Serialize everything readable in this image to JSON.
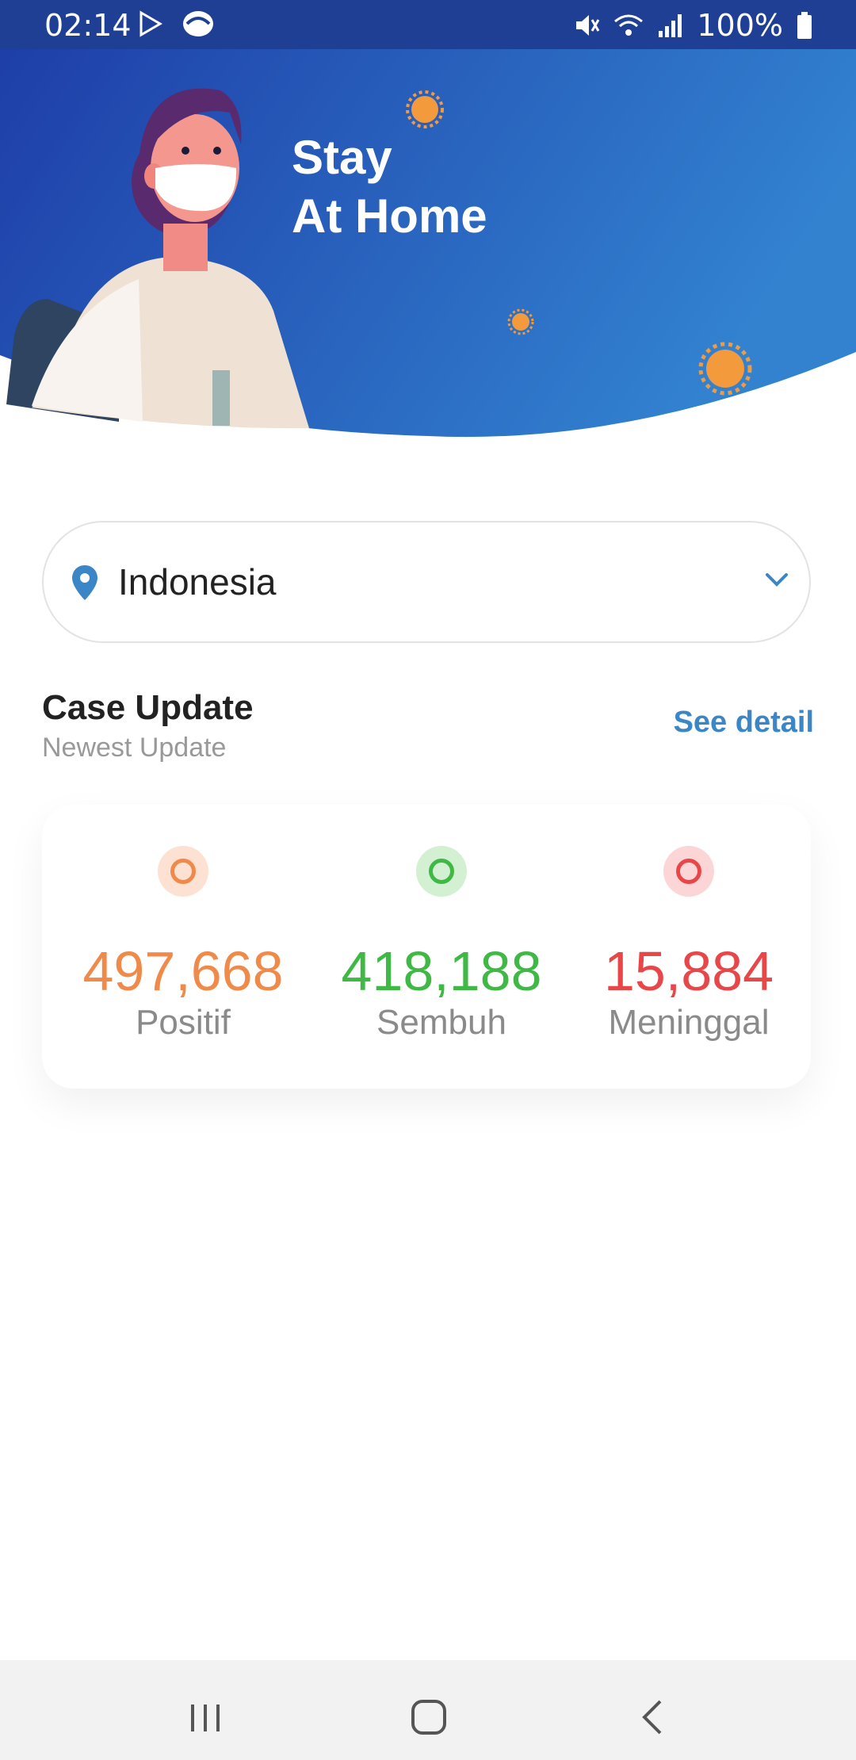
{
  "status_bar": {
    "time": "02:14",
    "battery": "100%",
    "icons": [
      "play-store-icon",
      "app-icon",
      "mute-icon",
      "wifi-icon",
      "signal-icon",
      "battery-icon"
    ]
  },
  "header": {
    "title_line1": "Stay",
    "title_line2": "At Home"
  },
  "country_select": {
    "value": "Indonesia"
  },
  "case_update": {
    "title": "Case Update",
    "subtitle": "Newest Update",
    "see_detail": "See detail"
  },
  "stats": [
    {
      "value": "497,668",
      "label": "Positif",
      "color": "#f08a4b"
    },
    {
      "value": "418,188",
      "label": "Sembuh",
      "color": "#3fb845"
    },
    {
      "value": "15,884",
      "label": "Meninggal",
      "color": "#e8474a"
    }
  ],
  "colors": {
    "header_start": "#1e3ea8",
    "header_end": "#3282d0",
    "accent": "#3a86c7"
  }
}
